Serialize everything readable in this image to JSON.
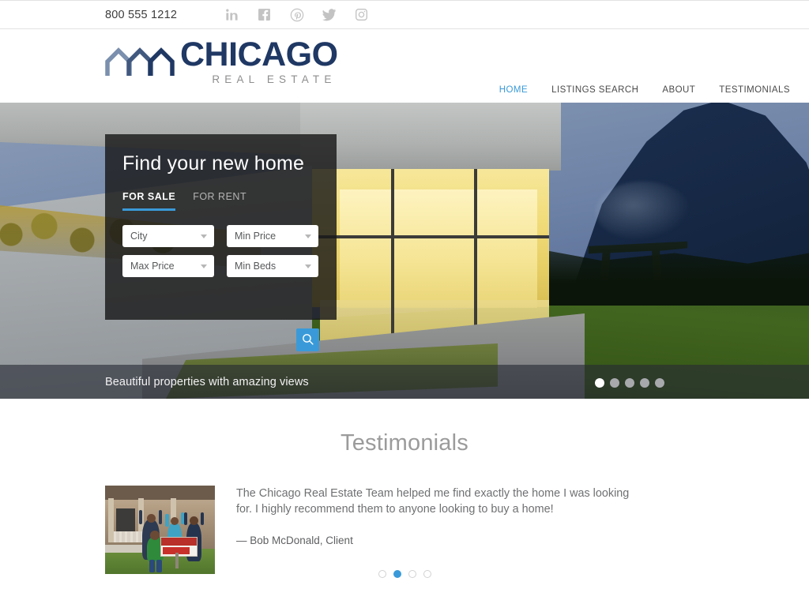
{
  "topbar": {
    "phone": "800 555 1212",
    "socials": [
      {
        "name": "linkedin-icon",
        "label": "LinkedIn"
      },
      {
        "name": "facebook-icon",
        "label": "Facebook"
      },
      {
        "name": "pinterest-icon",
        "label": "Pinterest"
      },
      {
        "name": "twitter-icon",
        "label": "Twitter"
      },
      {
        "name": "instagram-icon",
        "label": "Instagram"
      }
    ]
  },
  "brand": {
    "name": "CHICAGO",
    "tagline": "REAL ESTATE",
    "logo_icon": "house-rooflines-icon",
    "colors": {
      "navy": "#1f3864",
      "slate": "#5f7596",
      "gray": "#8e8e8e"
    }
  },
  "nav": {
    "items": [
      {
        "label": "HOME",
        "active": true
      },
      {
        "label": "LISTINGS SEARCH",
        "active": false
      },
      {
        "label": "ABOUT",
        "active": false
      },
      {
        "label": "TESTIMONIALS",
        "active": false
      }
    ],
    "accent_color": "#3a9ad9"
  },
  "hero": {
    "panel": {
      "title": "Find your new home",
      "tabs": [
        {
          "label": "FOR SALE",
          "active": true
        },
        {
          "label": "FOR RENT",
          "active": false
        }
      ],
      "fields": [
        {
          "name": "city",
          "value": "City"
        },
        {
          "name": "min-price",
          "value": "Min Price"
        },
        {
          "name": "max-price",
          "value": "Max Price"
        },
        {
          "name": "min-beds",
          "value": "Min Beds"
        }
      ],
      "search_icon": "magnifier-icon",
      "search_button_color": "#3a9ad9"
    },
    "caption": "Beautiful properties with amazing views",
    "slides": {
      "count": 5,
      "active_index": 0
    }
  },
  "testimonials": {
    "title": "Testimonials",
    "photo_alt": "family-in-front-of-house-with-sold-sign",
    "quote": "The Chicago Real Estate Team helped me find exactly the home I was looking for. I highly recommend them to anyone looking to buy a home!",
    "author": "— Bob McDonald, Client",
    "dots": {
      "count": 4,
      "active_index": 1,
      "active_color": "#3a9ad9"
    }
  }
}
